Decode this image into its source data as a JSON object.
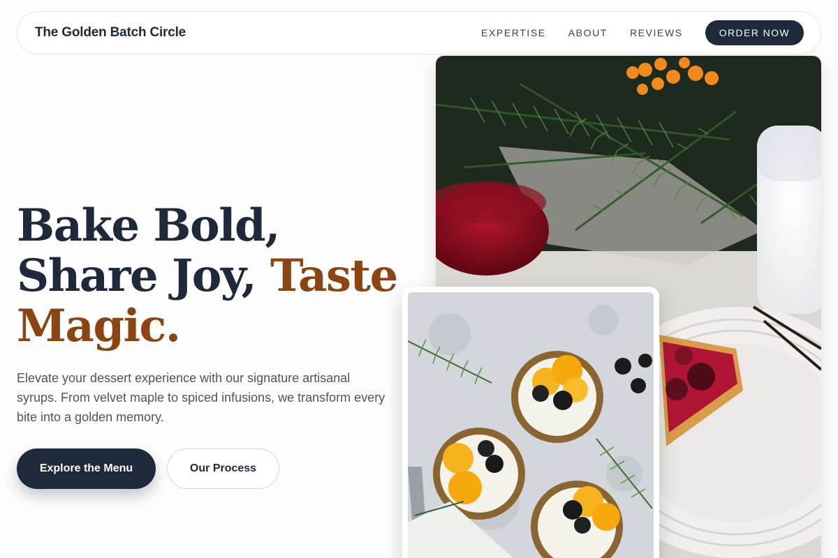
{
  "nav": {
    "brand": "The Golden Batch Circle",
    "links": [
      "EXPERTISE",
      "ABOUT",
      "REVIEWS"
    ],
    "cta": "ORDER NOW"
  },
  "hero": {
    "headline_line1": "Bake Bold,",
    "headline_line2_a": "Share Joy, ",
    "headline_line2_b": "Taste",
    "headline_line3": "Magic.",
    "subtext": "Elevate your dessert experience with our signature artisanal syrups. From velvet maple to spiced infusions, we transform every bite into a golden memory.",
    "primary_button": "Explore the Menu",
    "secondary_button": "Our Process"
  },
  "colors": {
    "navy": "#1e293b",
    "accent_brown": "#8b4513"
  }
}
